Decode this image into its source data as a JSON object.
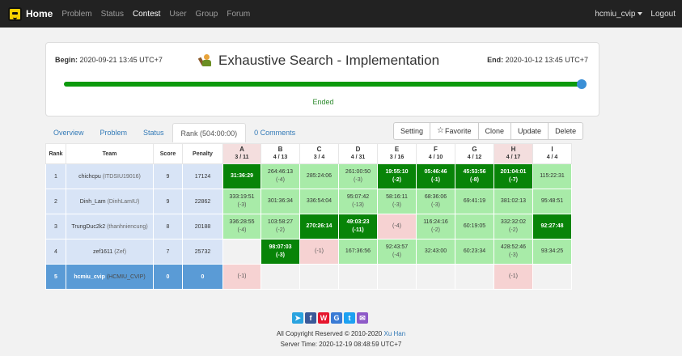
{
  "nav": {
    "brand": "Home",
    "links": [
      "Problem",
      "Status",
      "Contest",
      "User",
      "Group",
      "Forum"
    ],
    "active_index": 2,
    "user": "hcmiu_cvip",
    "logout": "Logout"
  },
  "contest": {
    "begin_label": "Begin:",
    "begin": "2020-09-21 13:45 UTC+7",
    "end_label": "End:",
    "end": "2020-10-12 13:45 UTC+7",
    "title": "Exhaustive Search - Implementation",
    "status": "Ended",
    "progress_percent": 100
  },
  "tabs": [
    "Overview",
    "Problem",
    "Status",
    "Rank (504:00:00)",
    "0 Comments"
  ],
  "active_tab": 3,
  "actions": {
    "setting": "Setting",
    "favorite": "Favorite",
    "clone": "Clone",
    "update": "Update",
    "delete": "Delete"
  },
  "rank": {
    "headers": {
      "rank": "Rank",
      "team": "Team",
      "score": "Score",
      "penalty": "Penalty"
    },
    "problems": [
      {
        "letter": "A",
        "ratio": "3 / 11"
      },
      {
        "letter": "B",
        "ratio": "4 / 13"
      },
      {
        "letter": "C",
        "ratio": "3 / 4"
      },
      {
        "letter": "D",
        "ratio": "4 / 31"
      },
      {
        "letter": "E",
        "ratio": "3 / 16"
      },
      {
        "letter": "F",
        "ratio": "4 / 10"
      },
      {
        "letter": "G",
        "ratio": "4 / 12"
      },
      {
        "letter": "H",
        "ratio": "4 / 17"
      },
      {
        "letter": "I",
        "ratio": "4 / 4"
      }
    ],
    "rows": [
      {
        "rank": "1",
        "user": "chichcpu",
        "nick": "(ITDSIU19016)",
        "score": "9",
        "penalty": "17124",
        "cells": [
          {
            "status": "fb",
            "time": "31:36:29",
            "tries": ""
          },
          {
            "status": "ac",
            "time": "264:46:13",
            "tries": "(-4)"
          },
          {
            "status": "ac",
            "time": "285:24:06",
            "tries": ""
          },
          {
            "status": "ac",
            "time": "261:00:50",
            "tries": "(-3)"
          },
          {
            "status": "fb",
            "time": "19:55:10",
            "tries": "(-2)"
          },
          {
            "status": "fb",
            "time": "05:46:46",
            "tries": "(-1)"
          },
          {
            "status": "fb",
            "time": "45:53:56",
            "tries": "(-8)"
          },
          {
            "status": "fb",
            "time": "201:04:01",
            "tries": "(-7)"
          },
          {
            "status": "ac",
            "time": "115:22:31",
            "tries": ""
          }
        ]
      },
      {
        "rank": "2",
        "user": "Dinh_Lam",
        "nick": "(DinhLamIU)",
        "score": "9",
        "penalty": "22862",
        "cells": [
          {
            "status": "ac",
            "time": "333:19:51",
            "tries": "(-3)"
          },
          {
            "status": "ac",
            "time": "301:36:34",
            "tries": ""
          },
          {
            "status": "ac",
            "time": "336:54:04",
            "tries": ""
          },
          {
            "status": "ac",
            "time": "95:07:42",
            "tries": "(-13)"
          },
          {
            "status": "ac",
            "time": "58:16:11",
            "tries": "(-3)"
          },
          {
            "status": "ac",
            "time": "68:36:06",
            "tries": "(-3)"
          },
          {
            "status": "ac",
            "time": "69:41:19",
            "tries": ""
          },
          {
            "status": "ac",
            "time": "381:02:13",
            "tries": ""
          },
          {
            "status": "ac",
            "time": "95:48:51",
            "tries": ""
          }
        ]
      },
      {
        "rank": "3",
        "user": "TrungDuc2k2",
        "nick": "(thanhniencung)",
        "score": "8",
        "penalty": "20188",
        "cells": [
          {
            "status": "ac",
            "time": "336:28:55",
            "tries": "(-4)"
          },
          {
            "status": "ac",
            "time": "103:58:27",
            "tries": "(-2)"
          },
          {
            "status": "fb",
            "time": "270:26:14",
            "tries": ""
          },
          {
            "status": "fb",
            "time": "49:03:23",
            "tries": "(-11)"
          },
          {
            "status": "wa",
            "time": "",
            "tries": "(-4)"
          },
          {
            "status": "ac",
            "time": "116:24:16",
            "tries": "(-2)"
          },
          {
            "status": "ac",
            "time": "60:19:05",
            "tries": ""
          },
          {
            "status": "ac",
            "time": "332:32:02",
            "tries": "(-2)"
          },
          {
            "status": "fb",
            "time": "92:27:48",
            "tries": ""
          }
        ]
      },
      {
        "rank": "4",
        "user": "zef1611",
        "nick": "(Zef)",
        "score": "7",
        "penalty": "25732",
        "cells": [
          {
            "status": "none",
            "time": "",
            "tries": ""
          },
          {
            "status": "fb",
            "time": "98:07:03",
            "tries": "(-3)"
          },
          {
            "status": "wa",
            "time": "",
            "tries": "(-1)"
          },
          {
            "status": "ac",
            "time": "167:36:56",
            "tries": ""
          },
          {
            "status": "ac",
            "time": "92:43:57",
            "tries": "(-4)"
          },
          {
            "status": "ac",
            "time": "32:43:00",
            "tries": ""
          },
          {
            "status": "ac",
            "time": "60:23:34",
            "tries": ""
          },
          {
            "status": "ac",
            "time": "428:52:46",
            "tries": "(-3)"
          },
          {
            "status": "ac",
            "time": "93:34:25",
            "tries": ""
          }
        ]
      },
      {
        "rank": "5",
        "user": "hcmiu_cvip",
        "nick": "(HCMIU_CVIP)",
        "score": "0",
        "penalty": "0",
        "me": true,
        "cells": [
          {
            "status": "wa",
            "time": "",
            "tries": "(-1)"
          },
          {
            "status": "none",
            "time": "",
            "tries": ""
          },
          {
            "status": "none",
            "time": "",
            "tries": ""
          },
          {
            "status": "none",
            "time": "",
            "tries": ""
          },
          {
            "status": "none",
            "time": "",
            "tries": ""
          },
          {
            "status": "none",
            "time": "",
            "tries": ""
          },
          {
            "status": "none",
            "time": "",
            "tries": ""
          },
          {
            "status": "wa",
            "time": "",
            "tries": "(-1)"
          },
          {
            "status": "none",
            "time": "",
            "tries": ""
          }
        ]
      }
    ]
  },
  "footer": {
    "share_icons": [
      {
        "name": "telegram-icon",
        "glyph": "➤",
        "color": "#2aa3df"
      },
      {
        "name": "facebook-icon",
        "glyph": "f",
        "color": "#3b5998"
      },
      {
        "name": "weibo-icon",
        "glyph": "W",
        "color": "#e6162d"
      },
      {
        "name": "google-icon",
        "glyph": "G",
        "color": "#3a7bd5"
      },
      {
        "name": "twitter-icon",
        "glyph": "t",
        "color": "#1da1f2"
      },
      {
        "name": "email-icon",
        "glyph": "✉",
        "color": "#8e5bc8"
      }
    ],
    "copyright": "All Copyright Reserved © 2010-2020",
    "author": "Xu Han",
    "server_time": "Server Time: 2020-12-19 08:48:59 UTC+7"
  }
}
